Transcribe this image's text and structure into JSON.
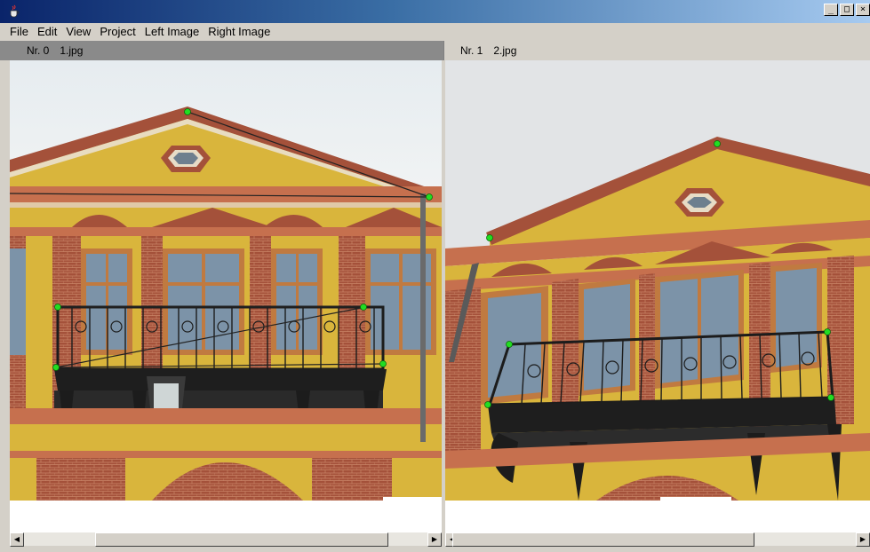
{
  "window": {
    "controls": {
      "minimize": "_",
      "maximize": "□",
      "close": "×"
    }
  },
  "menu": [
    "File",
    "Edit",
    "View",
    "Project",
    "Left Image",
    "Right Image"
  ],
  "panels": {
    "left": {
      "nr": "Nr. 0",
      "file": "1.jpg"
    },
    "right": {
      "nr": "Nr. 1",
      "file": "2.jpg"
    }
  },
  "colors": {
    "control_point": "#22dd22",
    "sky": "#e9eef2",
    "facade_yellow": "#d9b53c",
    "brick": "#a4513a",
    "window_frame": "#c07a40",
    "glass": "#7c93a8",
    "railing": "#1c1c1c"
  },
  "icons": {
    "app": "java-cup-icon",
    "scroll_left": "arrow-left-icon",
    "scroll_right": "arrow-right-icon"
  }
}
